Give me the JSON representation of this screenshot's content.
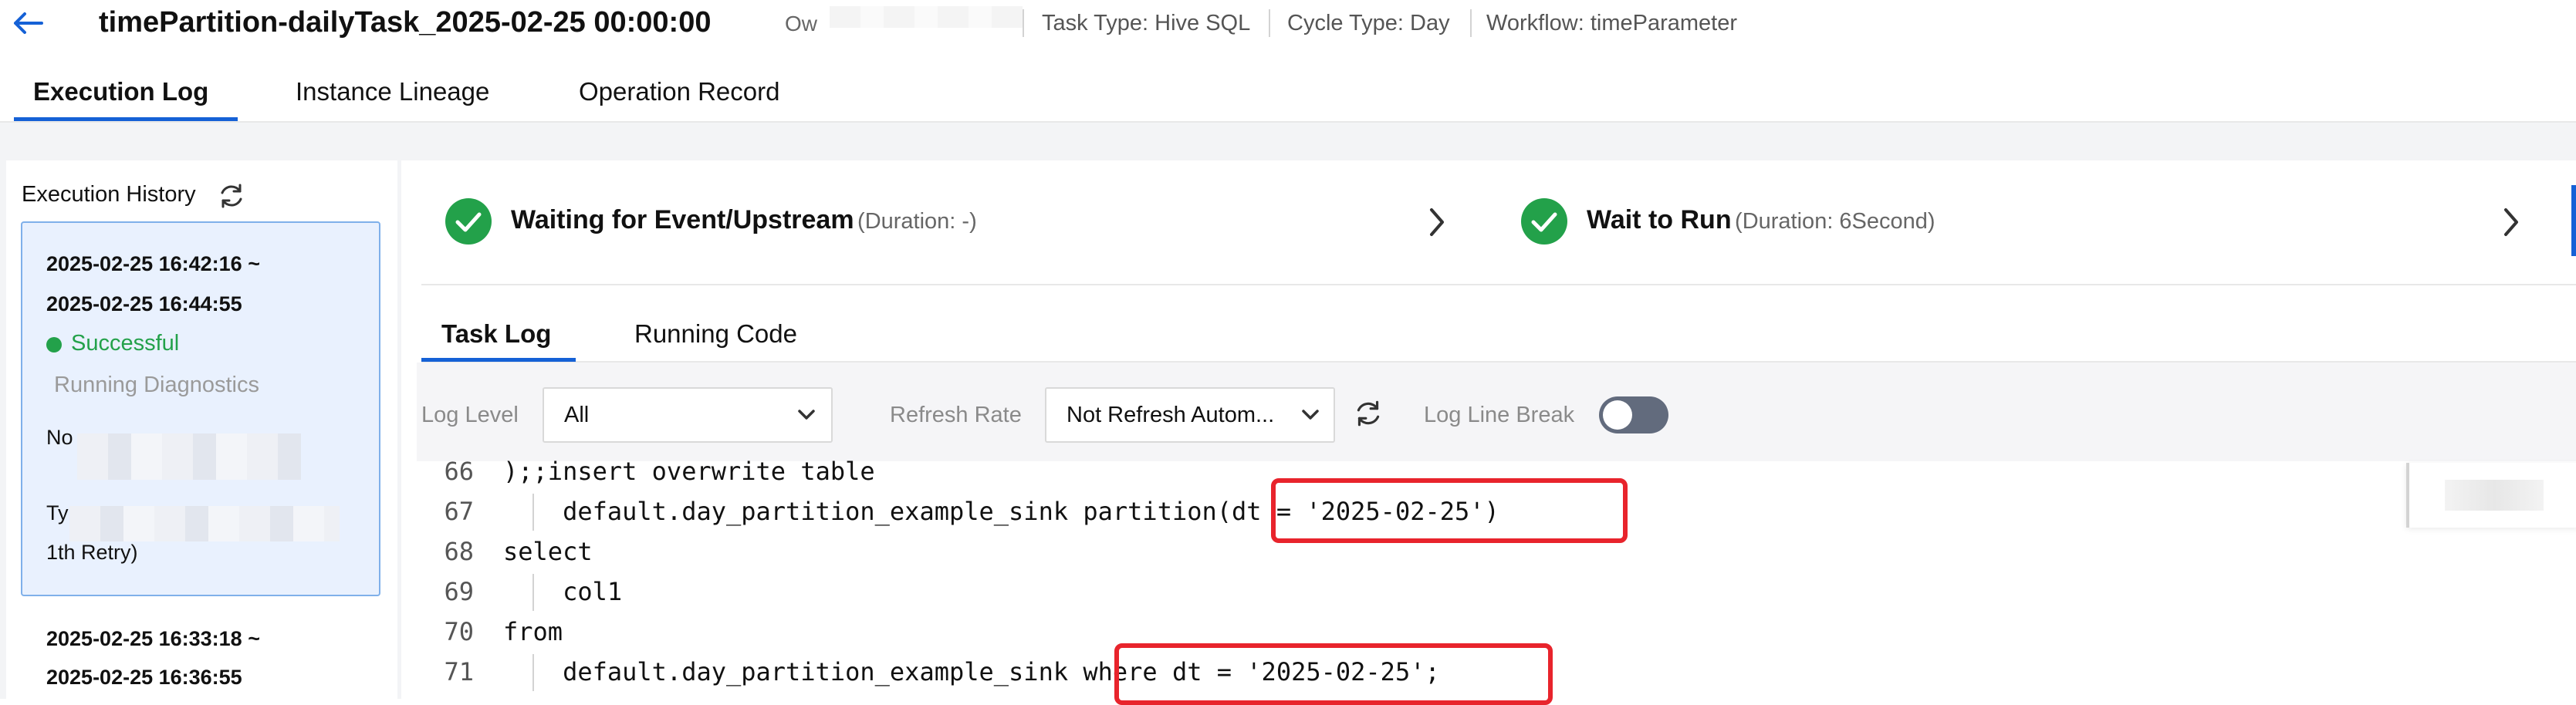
{
  "header": {
    "title": "timePartition-dailyTask_2025-02-25 00:00:00",
    "owner_label": "Ow",
    "task_type": "Task Type: Hive SQL",
    "cycle_type": "Cycle Type: Day",
    "workflow": "Workflow: timeParameter"
  },
  "tabs": [
    "Execution Log",
    "Instance Lineage",
    "Operation Record"
  ],
  "history": {
    "title": "Execution History",
    "runs": [
      {
        "start": "2025-02-25 16:42:16 ~",
        "end": "2025-02-25 16:44:55",
        "status": "Successful",
        "diagnostics": "Running Diagnostics",
        "node_label": "No",
        "type_label": "Ty",
        "retry": "1th Retry)"
      },
      {
        "start": "2025-02-25 16:33:18 ~",
        "end": "2025-02-25 16:36:55"
      }
    ]
  },
  "steps": [
    {
      "title": "Waiting for Event/Upstream",
      "duration": "(Duration: -)"
    },
    {
      "title": "Wait to Run",
      "duration": "(Duration: 6Second)"
    }
  ],
  "subtabs": [
    "Task Log",
    "Running Code"
  ],
  "toolbar": {
    "log_level_label": "Log Level",
    "log_level_value": "All",
    "refresh_rate_label": "Refresh Rate",
    "refresh_rate_value": "Not Refresh Autom...",
    "line_break_label": "Log Line Break"
  },
  "code_lines": [
    {
      "num": "66",
      "text": ");;insert overwrite table"
    },
    {
      "num": "67",
      "text": "    default.day_partition_example_sink partition(dt = '2025-02-25')"
    },
    {
      "num": "68",
      "text": "select"
    },
    {
      "num": "69",
      "text": "    col1"
    },
    {
      "num": "70",
      "text": "from"
    },
    {
      "num": "71",
      "text": "    default.day_partition_example_sink where dt = '2025-02-25';"
    }
  ],
  "colors": {
    "accent": "#1561d6",
    "success": "#23a14a",
    "highlight": "#e8242c",
    "selected_card_bg": "#e9f1fe"
  },
  "icons": [
    "back-arrow-icon",
    "refresh-icon",
    "check-circle-icon",
    "chevron-right-icon",
    "chevron-down-icon",
    "toggle-switch"
  ]
}
